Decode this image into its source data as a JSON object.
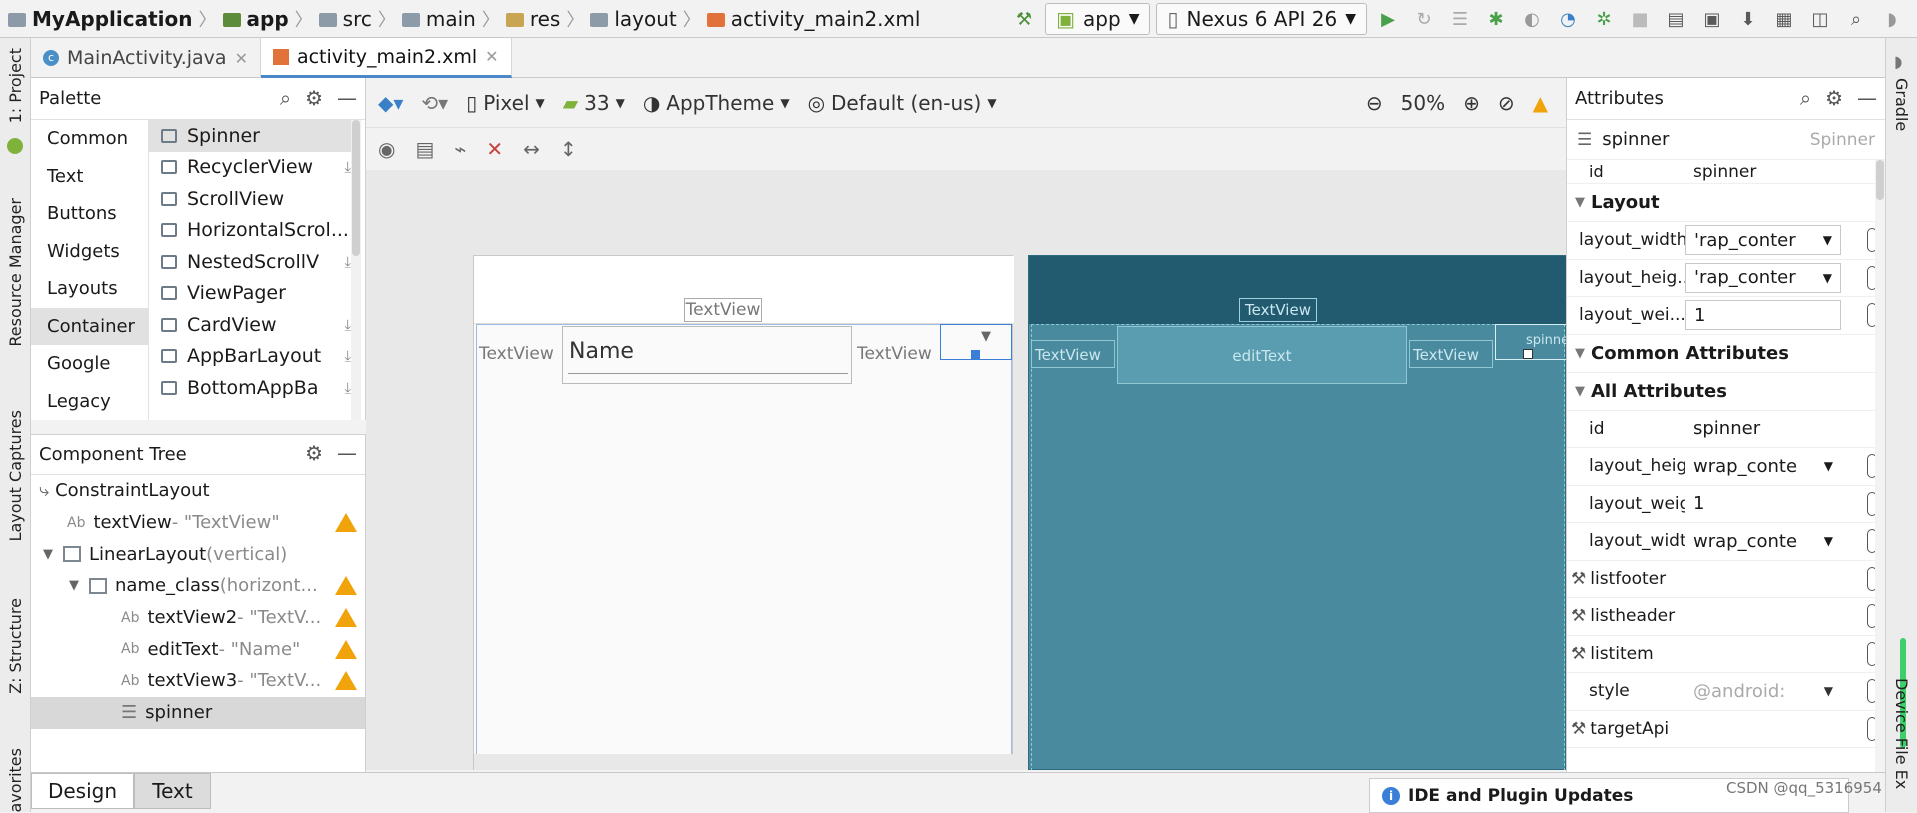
{
  "breadcrumb": {
    "project": "MyApplication",
    "parts": [
      "app",
      "src",
      "main",
      "res",
      "layout",
      "activity_main2.xml"
    ]
  },
  "toolbar": {
    "config": "app",
    "device": "Nexus 6 API 26"
  },
  "tabs": [
    {
      "label": "MainActivity.java",
      "active": false
    },
    {
      "label": "activity_main2.xml",
      "active": true
    }
  ],
  "left_strip": {
    "project": "1: Project",
    "resource_manager": "Resource Manager",
    "layout_captures": "Layout Captures",
    "structure": "Z: Structure",
    "favorites": "avorites"
  },
  "right_strip": {
    "gradle": "Gradle",
    "device_file": "Device File Ex"
  },
  "palette": {
    "title": "Palette",
    "categories": [
      "Common",
      "Text",
      "Buttons",
      "Widgets",
      "Layouts",
      "Container",
      "Google",
      "Legacy"
    ],
    "selected_category": "Container",
    "items": [
      {
        "label": "Spinner"
      },
      {
        "label": "RecyclerView"
      },
      {
        "label": "ScrollView"
      },
      {
        "label": "HorizontalScrol..."
      },
      {
        "label": "NestedScrollV"
      },
      {
        "label": "ViewPager"
      },
      {
        "label": "CardView"
      },
      {
        "label": "AppBarLayout"
      },
      {
        "label": "BottomAppBa"
      }
    ]
  },
  "component_tree": {
    "title": "Component Tree",
    "rows": [
      {
        "label": "ConstraintLayout",
        "suffix": "",
        "warn": false
      },
      {
        "label": "textView",
        "suffix": "- \"TextView\"",
        "warn": true
      },
      {
        "label": "LinearLayout",
        "suffix": "(vertical)",
        "warn": false
      },
      {
        "label": "name_class",
        "suffix": "(horizont...",
        "warn": true
      },
      {
        "label": "textView2",
        "suffix": "- \"TextV...",
        "warn": true
      },
      {
        "label": "editText",
        "suffix": "- \"Name\"",
        "warn": true
      },
      {
        "label": "textView3",
        "suffix": "- \"TextV...",
        "warn": true
      },
      {
        "label": "spinner",
        "suffix": "",
        "warn": false
      }
    ]
  },
  "design_toolbar": {
    "device": "Pixel",
    "api": "33",
    "theme": "AppTheme",
    "locale": "Default (en-us)",
    "zoom": "50%"
  },
  "canvas": {
    "design": {
      "textview_top": "TextView",
      "textview_left": "TextView",
      "edit_name": "Name",
      "textview_right": "TextView"
    },
    "blueprint": {
      "textview_top": "TextView",
      "textview_left": "TextView",
      "edit": "editText",
      "textview_right": "TextView",
      "spinner": "spinner"
    }
  },
  "attributes": {
    "title": "Attributes",
    "component_name": "spinner",
    "component_type": "Spinner",
    "id_top": {
      "name": "id",
      "value": "spinner"
    },
    "layout_section": "Layout",
    "layout_rows": [
      {
        "name": "layout_width",
        "value": "'rap_conter"
      },
      {
        "name": "layout_heig...",
        "value": "'rap_conter"
      },
      {
        "name": "layout_wei...",
        "value": "1"
      }
    ],
    "common_section": "Common Attributes",
    "all_section": "All Attributes",
    "all_rows": [
      {
        "name": "id",
        "value": "spinner"
      },
      {
        "name": "layout_heig",
        "value": "wrap_conte"
      },
      {
        "name": "layout_weig",
        "value": "1"
      },
      {
        "name": "layout_widtl",
        "value": "wrap_conte"
      },
      {
        "name": "listfooter",
        "value": ""
      },
      {
        "name": "listheader",
        "value": ""
      },
      {
        "name": "listitem",
        "value": ""
      },
      {
        "name": "style",
        "value": "@android:"
      },
      {
        "name": "targetApi",
        "value": ""
      }
    ]
  },
  "bottom_tabs": {
    "design": "Design",
    "text": "Text"
  },
  "notification": "IDE and Plugin Updates",
  "watermark": "CSDN @qq_5316954"
}
